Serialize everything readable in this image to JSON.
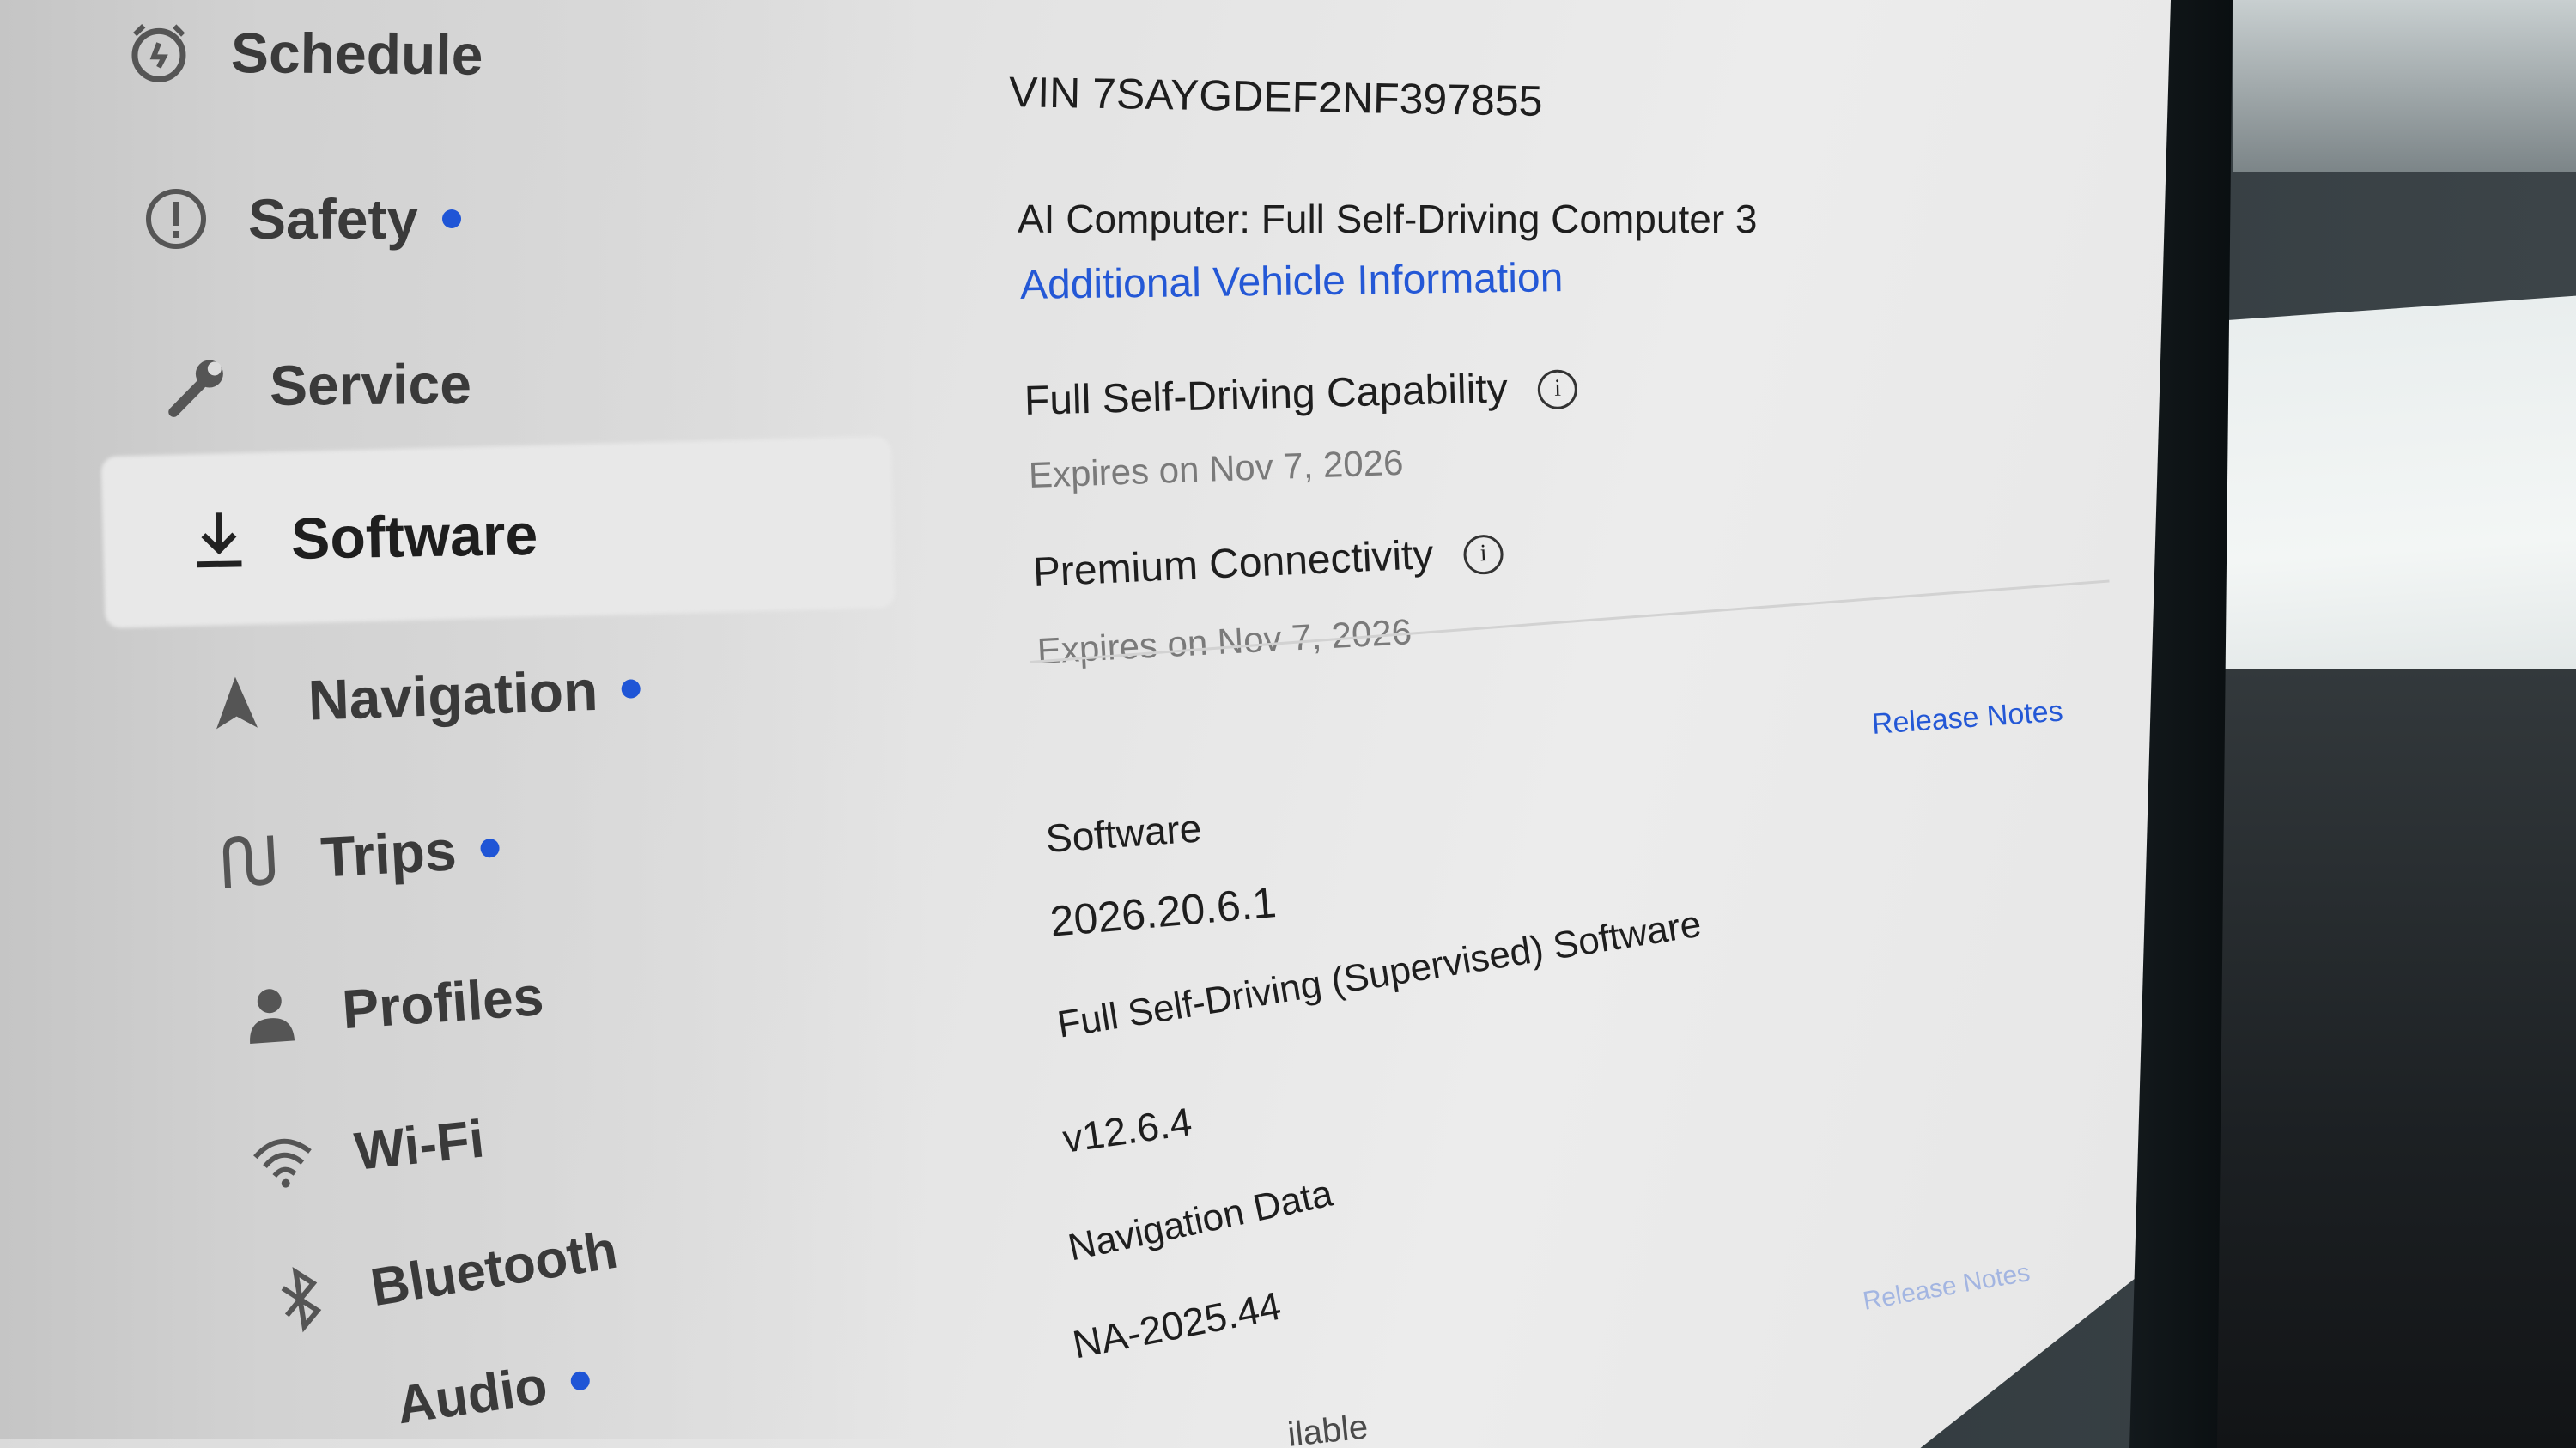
{
  "sidebar": {
    "items": [
      {
        "label": "Schedule",
        "icon": "alarm-clock-icon",
        "dot": false
      },
      {
        "label": "Safety",
        "icon": "alert-circle-icon",
        "dot": true
      },
      {
        "label": "Service",
        "icon": "wrench-icon",
        "dot": false
      },
      {
        "label": "Software",
        "icon": "download-icon",
        "dot": false,
        "active": true
      },
      {
        "label": "Navigation",
        "icon": "navigation-arrow-icon",
        "dot": true
      },
      {
        "label": "Trips",
        "icon": "trips-icon",
        "dot": true
      },
      {
        "label": "Profiles",
        "icon": "person-icon",
        "dot": false
      },
      {
        "label": "Wi-Fi",
        "icon": "wifi-icon",
        "dot": false
      },
      {
        "label": "Bluetooth",
        "icon": "bluetooth-icon",
        "dot": false
      },
      {
        "label": "Audio",
        "icon": "audio-icon",
        "dot": true
      }
    ]
  },
  "vehicle": {
    "vin": "VIN 7SAYGDEF2NF397855",
    "ai_computer": "AI Computer: Full Self-Driving Computer 3",
    "additional_info_link": "Additional Vehicle Information"
  },
  "packages": [
    {
      "name": "Full Self-Driving Capability",
      "expires": "Expires on Nov 7, 2026"
    },
    {
      "name": "Premium Connectivity",
      "expires": "Expires on Nov 7, 2026"
    }
  ],
  "software": {
    "release_notes_link": "Release Notes",
    "label": "Software",
    "version": "2026.20.6.1",
    "fsd_label": "Full Self-Driving (Supervised) Software",
    "fsd_version": "v12.6.4",
    "nav_label": "Navigation Data",
    "nav_version": "NA-2025.44",
    "nav_release_notes_link": "Release Notes",
    "bottom_partial": "ilable"
  },
  "colors": {
    "accent": "#1f55d6",
    "link": "#2458d6",
    "screen_bg": "#e3e3e3",
    "sidebar_text": "#3a3a3a"
  }
}
